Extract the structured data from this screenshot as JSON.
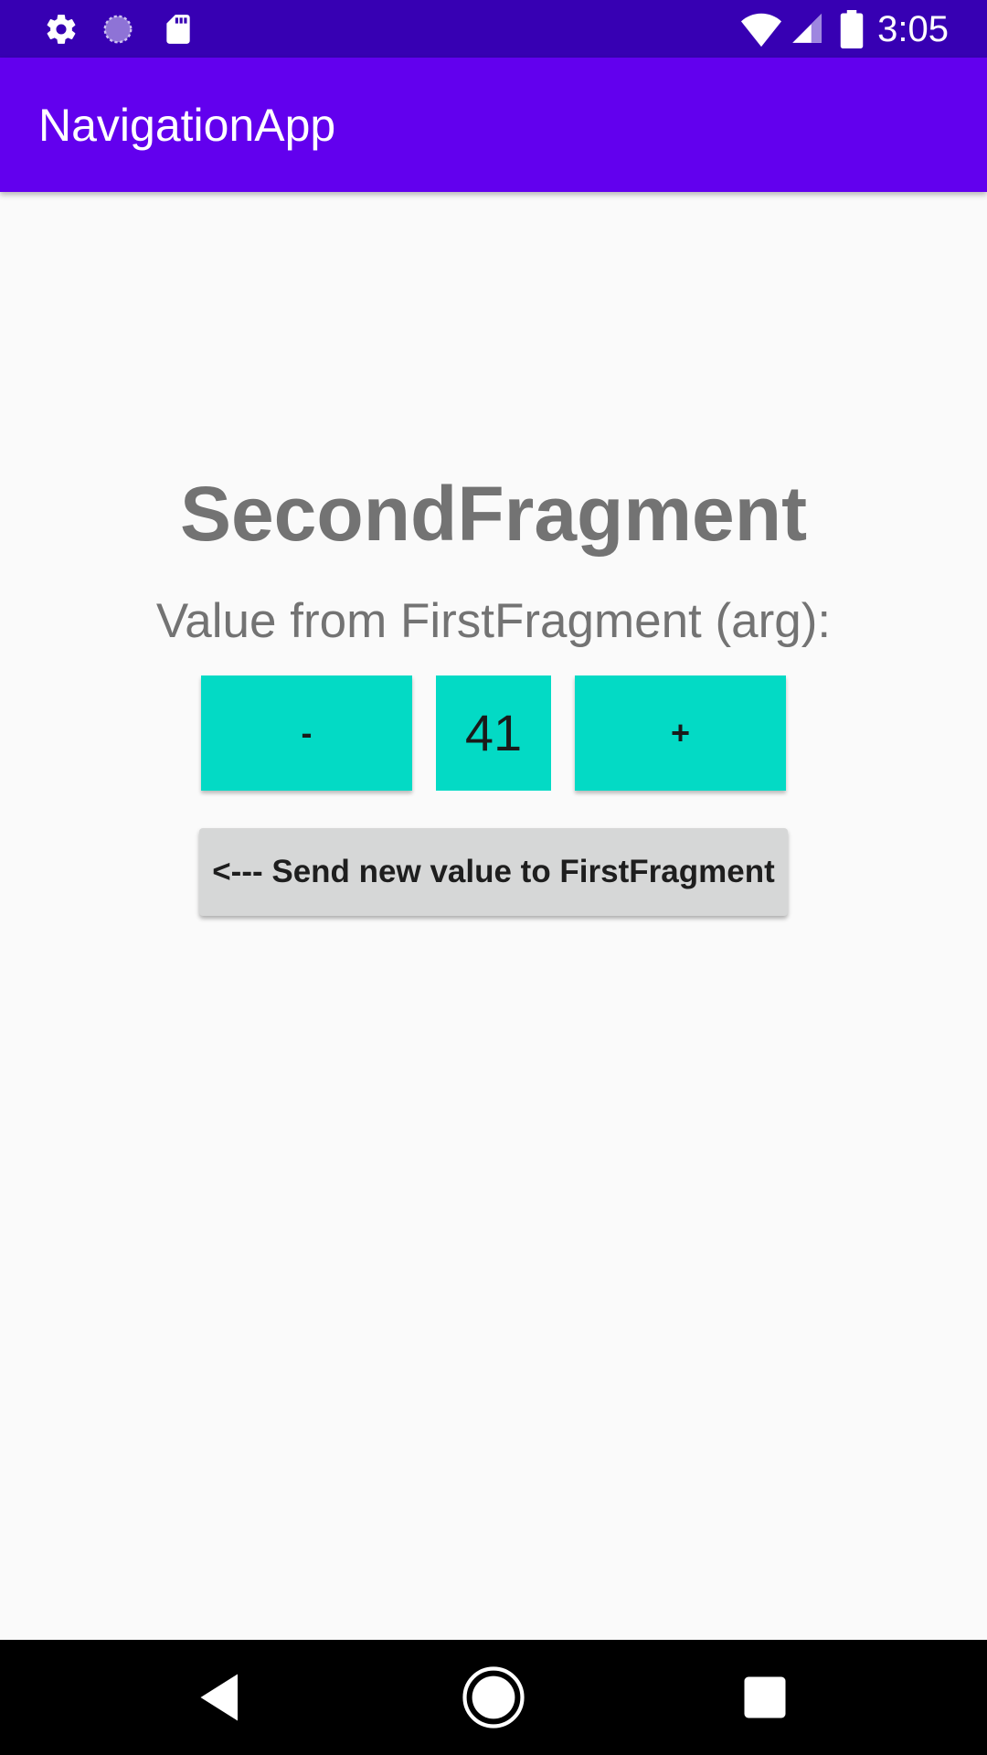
{
  "status_bar": {
    "time": "3:05",
    "left_icons": [
      "settings-icon",
      "sync-progress-icon",
      "sd-card-icon"
    ],
    "right_icons": [
      "wifi-icon",
      "cellular-signal-icon",
      "battery-icon"
    ],
    "background": "#3700b3"
  },
  "app_bar": {
    "title": "NavigationApp",
    "background": "#6200ee"
  },
  "main": {
    "title": "SecondFragment",
    "value_label": "Value from FirstFragment (arg):",
    "decrement_label": "-",
    "value": "41",
    "increment_label": "+",
    "send_button_label": "<--- Send new value to FirstFragment",
    "accent_color": "#03dac5"
  },
  "nav_bar": {
    "icons": [
      "back-icon",
      "home-icon",
      "recents-icon"
    ]
  }
}
